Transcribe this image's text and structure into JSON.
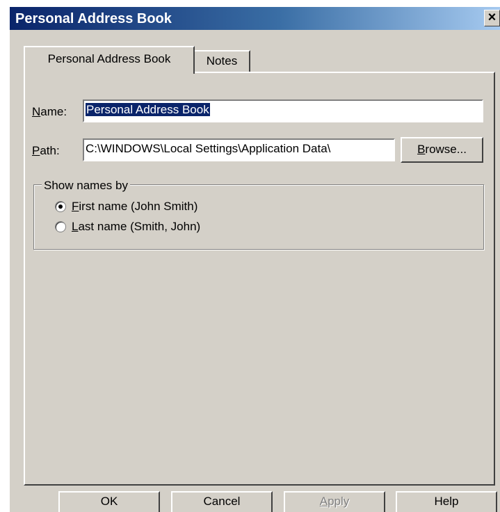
{
  "window": {
    "title": "Personal Address Book",
    "close_glyph": "×",
    "close_icon": "close-icon"
  },
  "tabs": [
    {
      "label": "Personal Address Book",
      "active": true
    },
    {
      "label": "Notes",
      "active": false
    }
  ],
  "form": {
    "name": {
      "label": "Name:",
      "accesskey": "N",
      "value": "Personal Address Book",
      "selected": true
    },
    "path": {
      "label": "Path:",
      "accesskey": "P",
      "value": "C:\\WINDOWS\\Local Settings\\Application Data\\"
    },
    "browse_label": "Browse...",
    "browse_accesskey": "B"
  },
  "show_names": {
    "title": "Show names by",
    "options": [
      {
        "label": "First name (John Smith)",
        "accesskey": "F",
        "checked": true
      },
      {
        "label": "Last name (Smith, John)",
        "accesskey": "L",
        "checked": false
      }
    ]
  },
  "buttons": {
    "ok": "OK",
    "cancel": "Cancel",
    "apply": "Apply",
    "apply_accesskey": "A",
    "apply_enabled": false,
    "help": "Help"
  },
  "colors": {
    "titlebar_start": "#0a246a",
    "titlebar_end": "#a6caf0",
    "face": "#d4d0c8",
    "selection": "#0a246a"
  }
}
